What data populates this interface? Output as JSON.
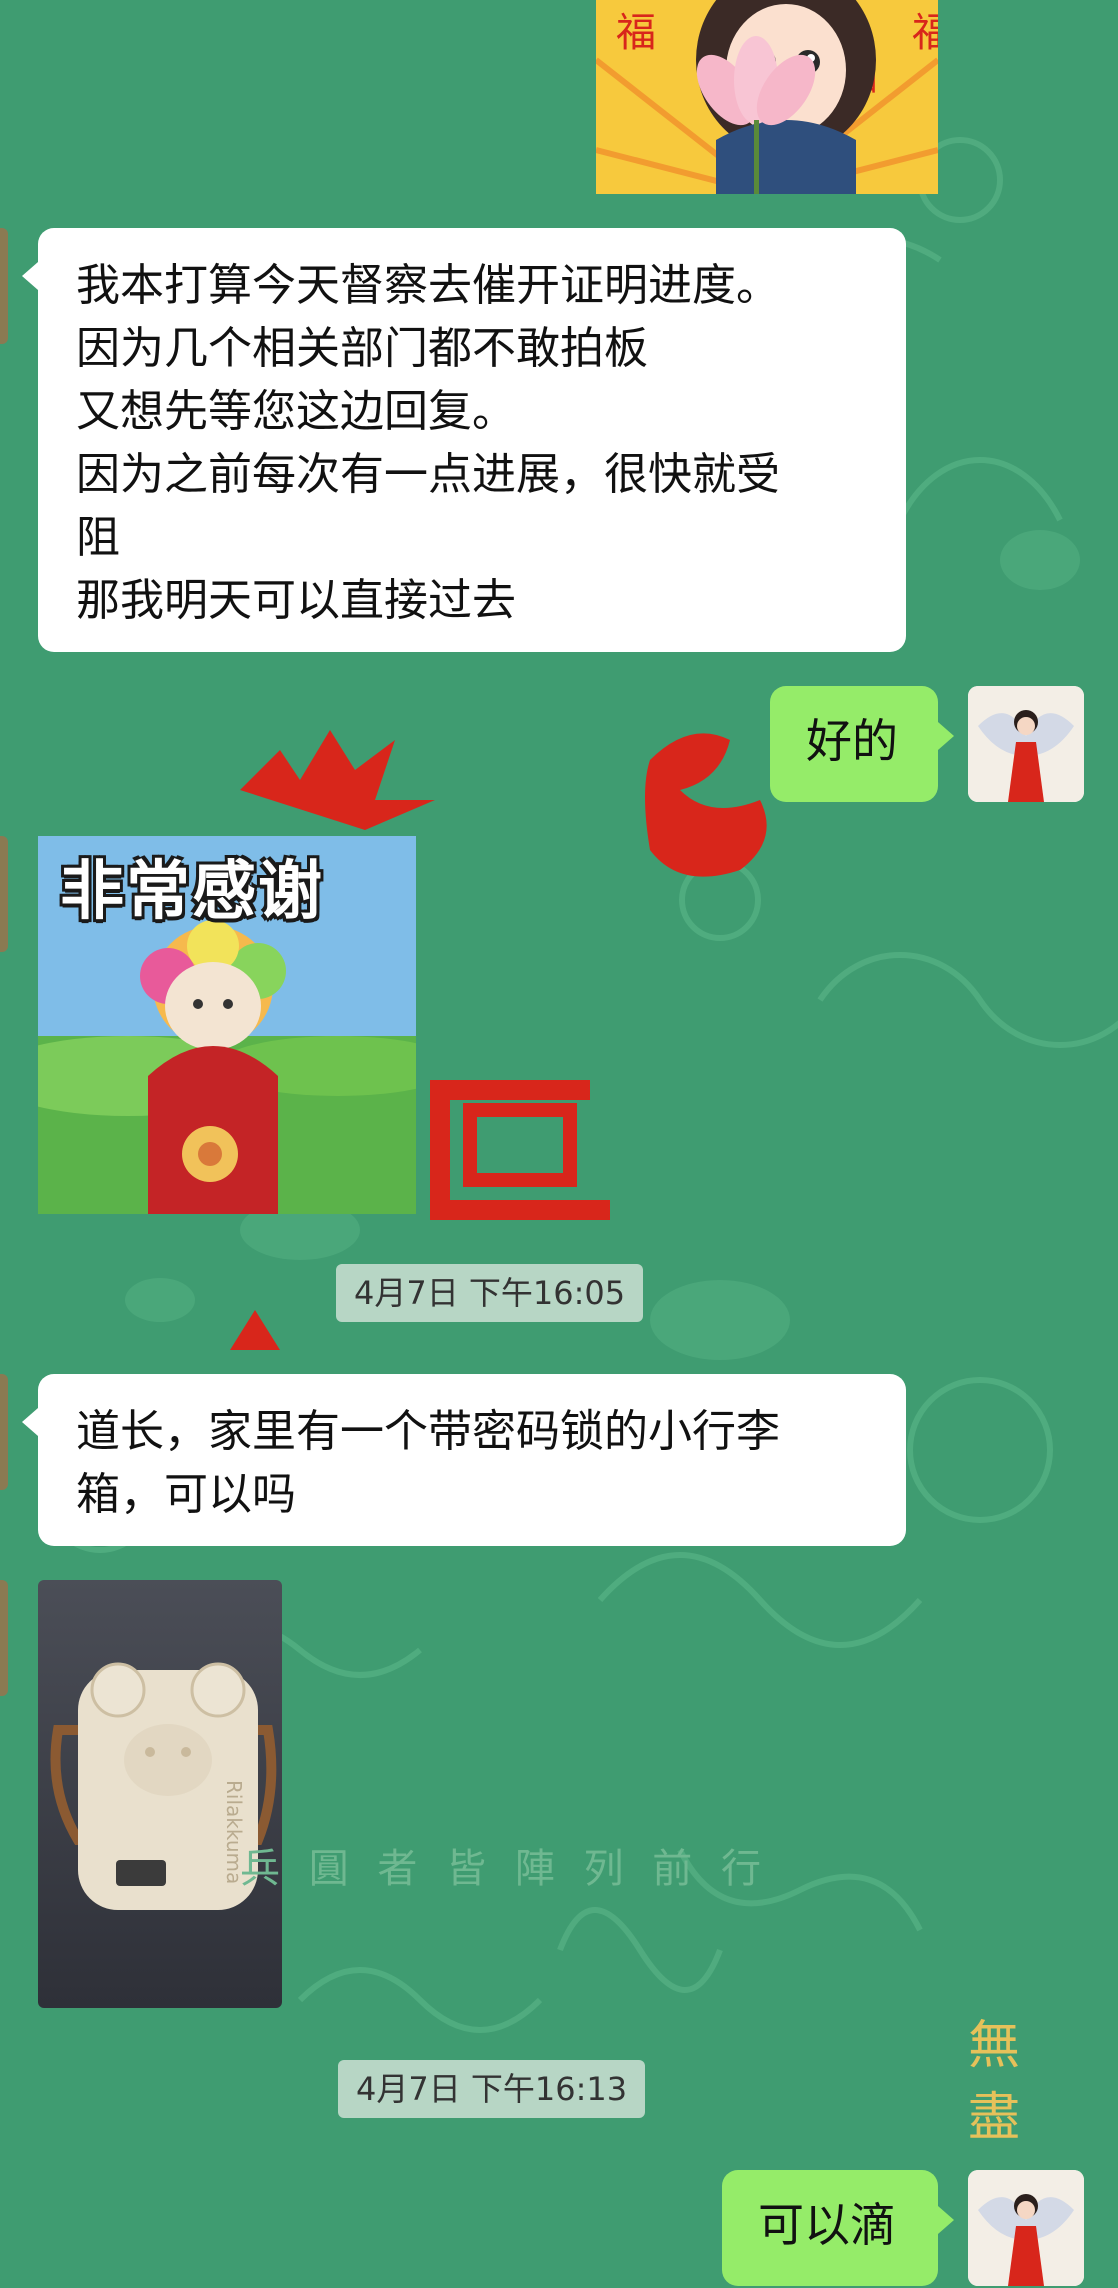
{
  "conversation": {
    "messages": [
      {
        "type": "sticker",
        "side": "left",
        "description": "cartoon girl holding lotus"
      },
      {
        "type": "text",
        "side": "left",
        "text": "我本打算今天督察去催开证明进度。\n因为几个相关部门都不敢拍板\n又想先等您这边回复。\n因为之前每次有一点进展，很快就受\n阻\n那我明天可以直接过去"
      },
      {
        "type": "text",
        "side": "right",
        "text": "好的"
      },
      {
        "type": "sticker",
        "side": "left",
        "caption": "非常感谢"
      },
      {
        "type": "timestamp",
        "text": "4月7日 下午16:05"
      },
      {
        "type": "text",
        "side": "left",
        "text": "道长，家里有一个带密码锁的小行李\n箱，可以吗"
      },
      {
        "type": "image",
        "side": "left",
        "label": "Rilakkuma"
      },
      {
        "type": "timestamp",
        "text": "4月7日 下午16:13"
      },
      {
        "type": "text",
        "side": "right",
        "text": "可以滴"
      }
    ]
  },
  "background": {
    "color": "#3f9c71",
    "watermark_text": "兵 圓 者 皆 陣 列 前 行",
    "right_vertical_text": "無 盡"
  },
  "colors": {
    "incoming": "#ffffff",
    "outgoing": "#95ec69",
    "timestamp_bg": "#cde1d4"
  }
}
